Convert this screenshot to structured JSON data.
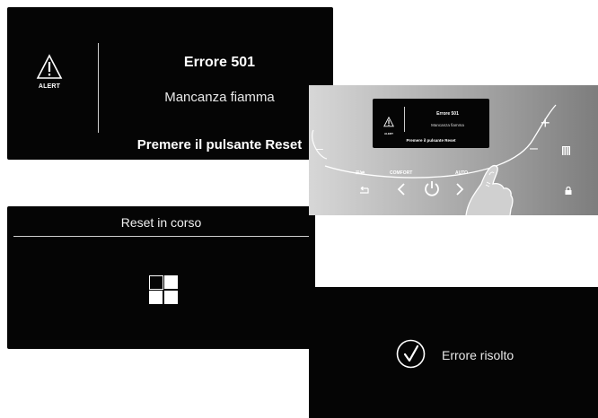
{
  "alert_panel": {
    "alert_label": "ALERT",
    "error_code": "Errore 501",
    "error_description": "Mancanza fiamma",
    "instruction": "Premere il pulsante Reset"
  },
  "reset_panel": {
    "title": "Reset in corso"
  },
  "device": {
    "screen": {
      "alert_label": "ALERT",
      "error_code": "Errore 501",
      "error_description": "Mancanza fiamma",
      "instruction": "Premere il pulsante Reset"
    },
    "buttons": {
      "back_label": "☰/⇄",
      "comfort_label": "COMFORT",
      "auto_label": "AUTO",
      "plus": "+",
      "minus": "–"
    }
  },
  "resolved_panel": {
    "message": "Errore risolto"
  },
  "icons": [
    "alert-triangle-icon",
    "check-circle-icon",
    "power-icon",
    "back-arrow-icon",
    "chevron-left-icon",
    "chevron-right-icon",
    "radiator-icon",
    "lock-icon",
    "finger-hand-icon"
  ]
}
